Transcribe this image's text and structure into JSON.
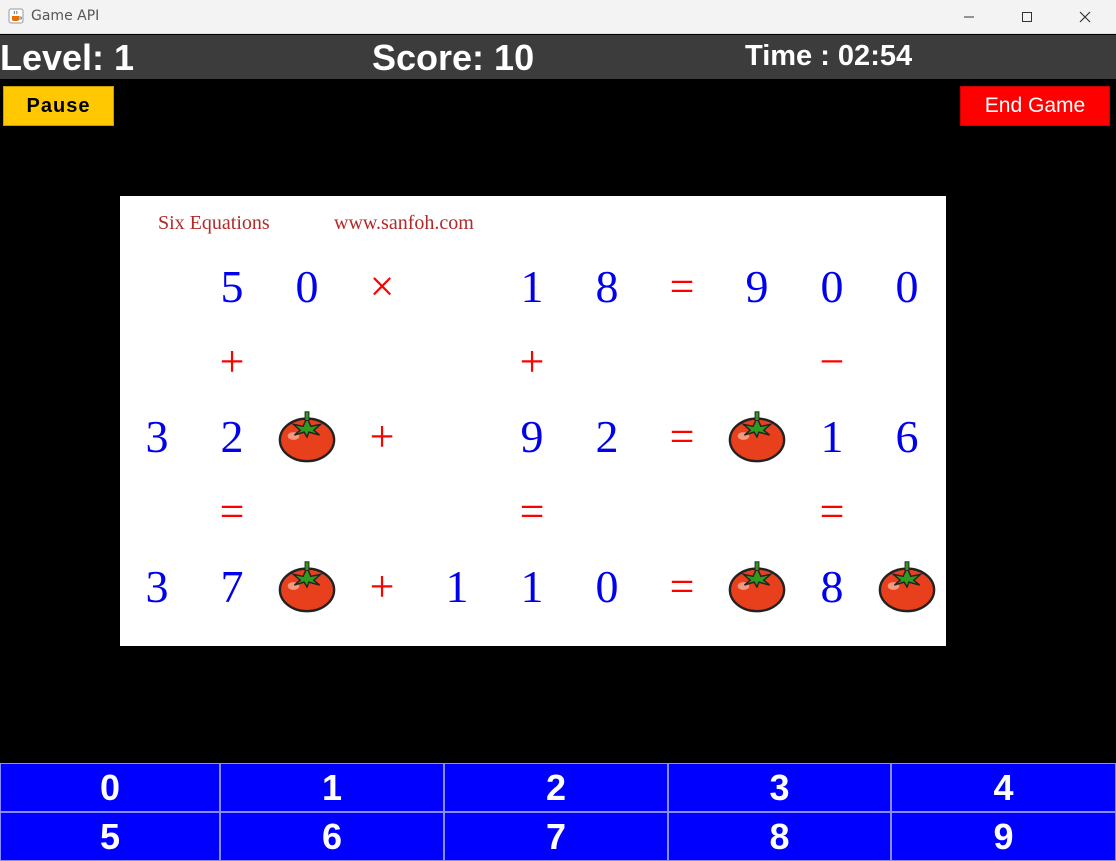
{
  "window": {
    "title": "Game API",
    "icon": "java-coffee-icon"
  },
  "status": {
    "level": "Level: 1",
    "score": "Score: 10",
    "time": "Time : 02:54"
  },
  "buttons": {
    "pause": "Pause",
    "end_game": "End Game"
  },
  "board": {
    "caption_title": "Six Equations",
    "caption_url": "www.sanfoh.com",
    "unknown_icon": "tomato-icon",
    "rows": [
      [
        "",
        "5",
        "0",
        "×",
        "",
        "1",
        "8",
        "=",
        "9",
        "0",
        "0"
      ],
      [
        "",
        "+",
        "",
        "",
        "",
        "+",
        "",
        "",
        "",
        "−",
        ""
      ],
      [
        "3",
        "2",
        "?",
        "+",
        "",
        "9",
        "2",
        "=",
        "?",
        "1",
        "6"
      ],
      [
        "",
        "=",
        "",
        "",
        "",
        "=",
        "",
        "",
        "",
        "=",
        ""
      ],
      [
        "3",
        "7",
        "?",
        "+",
        "1",
        "1",
        "0",
        "=",
        "?",
        "8",
        "?"
      ]
    ]
  },
  "keypad": {
    "keys": [
      "0",
      "1",
      "2",
      "3",
      "4",
      "5",
      "6",
      "7",
      "8",
      "9"
    ]
  },
  "colors": {
    "digit": "#0000ee",
    "operator": "#ff0000",
    "keypad": "#0000ff",
    "pause": "#ffc800",
    "end_game": "#ff0000"
  }
}
